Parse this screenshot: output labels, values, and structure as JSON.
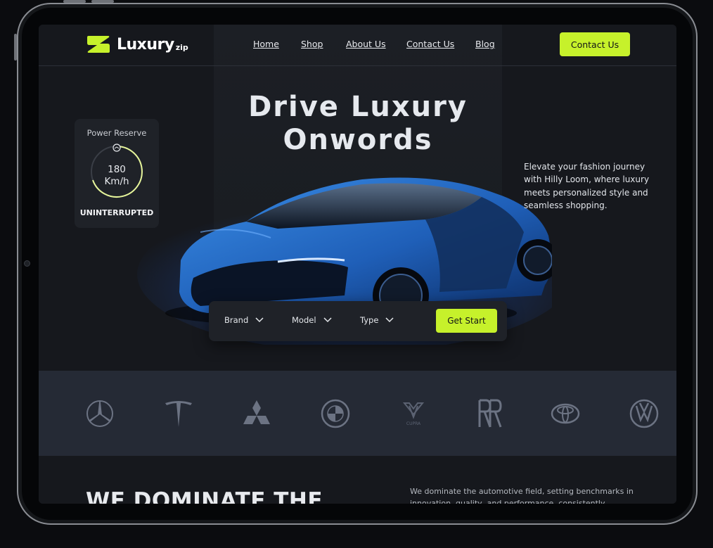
{
  "brand": {
    "name": "Luxury",
    "suffix": "zip",
    "accent": "#c6f12b"
  },
  "nav": {
    "items": [
      "Home",
      "Shop",
      "About Us",
      "Contact Us",
      "Blog"
    ],
    "cta": "Contact Us"
  },
  "hero": {
    "title_line1": "Drive Luxury",
    "title_line2": "Onwords",
    "description": "Elevate your fashion journey with Hilly Loom, where luxury meets personalized style and seamless shopping."
  },
  "power": {
    "label": "Power Reserve",
    "value": "180",
    "unit": "Km/h",
    "footer": "UNINTERRUPTED"
  },
  "filter": {
    "brand": "Brand",
    "model": "Model",
    "type": "Type",
    "button": "Get Start"
  },
  "brands": [
    "mercedes-benz-logo",
    "tesla-logo",
    "mitsubishi-logo",
    "bmw-logo",
    "cupra-logo",
    "rolls-royce-logo",
    "toyota-logo",
    "volkswagen-logo"
  ],
  "cupra_text": "CUPRA",
  "section": {
    "heading": "WE DOMINATE THE",
    "description": "We dominate the automotive field, setting benchmarks in innovation, quality, and performance, consistently leading"
  }
}
